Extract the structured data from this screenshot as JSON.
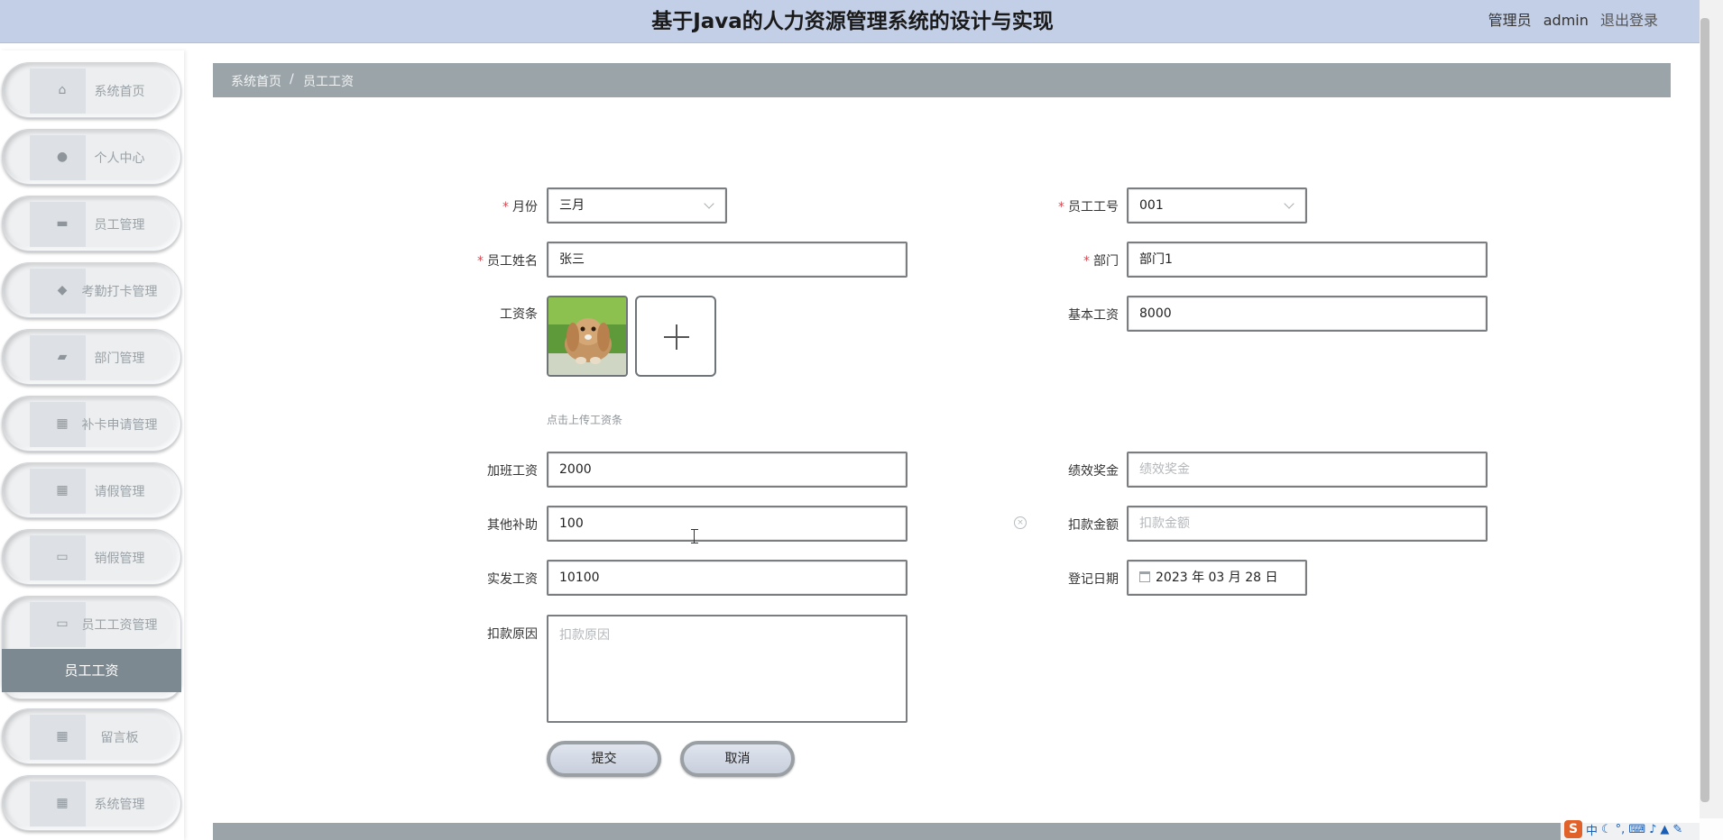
{
  "header": {
    "title": "基于Java的人力资源管理系统的设计与实现",
    "role": "管理员",
    "username": "admin",
    "logout": "退出登录"
  },
  "sidebar": {
    "items": [
      {
        "label": "系统首页",
        "icon": "home-icon"
      },
      {
        "label": "个人中心",
        "icon": "user-icon"
      },
      {
        "label": "员工管理",
        "icon": "chat-icon"
      },
      {
        "label": "考勤打卡管理",
        "icon": "pin-icon"
      },
      {
        "label": "部门管理",
        "icon": "ticket-icon"
      },
      {
        "label": "补卡申请管理",
        "icon": "grid-icon"
      },
      {
        "label": "请假管理",
        "icon": "grid-icon"
      },
      {
        "label": "销假管理",
        "icon": "monitor-icon"
      },
      {
        "label": "员工工资管理",
        "icon": "monitor-icon"
      },
      {
        "label": "留言板",
        "icon": "grid-icon"
      },
      {
        "label": "系统管理",
        "icon": "grid-icon"
      }
    ],
    "submenu_active": "员工工资"
  },
  "breadcrumb": {
    "home": "系统首页",
    "separator": "/",
    "current": "员工工资"
  },
  "form": {
    "month": {
      "label": "月份",
      "value": "三月"
    },
    "emp_no": {
      "label": "员工工号",
      "value": "001"
    },
    "emp_name": {
      "label": "员工姓名",
      "value": "张三"
    },
    "dept": {
      "label": "部门",
      "value": "部门1"
    },
    "payslip": {
      "label": "工资条",
      "hint": "点击上传工资条"
    },
    "base_salary": {
      "label": "基本工资",
      "value": "8000"
    },
    "overtime": {
      "label": "加班工资",
      "value": "2000"
    },
    "bonus": {
      "label": "绩效奖金",
      "placeholder": "绩效奖金"
    },
    "allowance": {
      "label": "其他补助",
      "value": "100"
    },
    "deduction": {
      "label": "扣款金额",
      "placeholder": "扣款金额"
    },
    "net_pay": {
      "label": "实发工资",
      "value": "10100"
    },
    "reg_date": {
      "label": "登记日期",
      "value": "2023 年 03 月 28 日"
    },
    "deduct_reason": {
      "label": "扣款原因",
      "placeholder": "扣款原因"
    },
    "submit": "提交",
    "cancel": "取消"
  },
  "ime": {
    "logo": "S",
    "lang": "中"
  }
}
